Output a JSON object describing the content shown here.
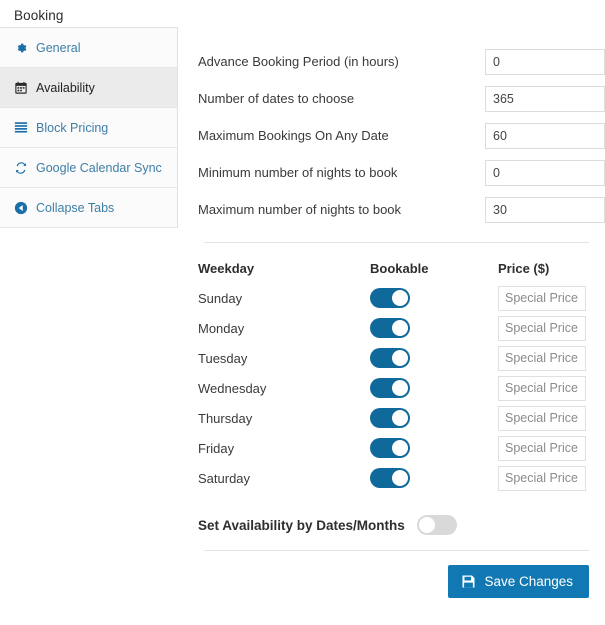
{
  "header": {
    "title": "Booking"
  },
  "sidebar": {
    "items": [
      {
        "label": "General",
        "icon": "gear-icon",
        "active": false
      },
      {
        "label": "Availability",
        "icon": "calendar-icon",
        "active": true
      },
      {
        "label": "Block Pricing",
        "icon": "list-bars-icon",
        "active": false
      },
      {
        "label": "Google Calendar Sync",
        "icon": "sync-refresh-icon",
        "active": false
      },
      {
        "label": "Collapse Tabs",
        "icon": "circle-caret-left-icon",
        "active": false
      }
    ]
  },
  "main": {
    "fields": [
      {
        "label": "Advance Booking Period (in hours)",
        "value": "0"
      },
      {
        "label": "Number of dates to choose",
        "value": "365"
      },
      {
        "label": "Maximum Bookings On Any Date",
        "value": "60"
      },
      {
        "label": "Minimum number of nights to book",
        "value": "0"
      },
      {
        "label": "Maximum number of nights to book",
        "value": "30"
      }
    ],
    "weekday_table": {
      "headers": {
        "day": "Weekday",
        "bookable": "Bookable",
        "price": "Price ($)"
      },
      "price_placeholder": "Special Price",
      "rows": [
        {
          "day": "Sunday",
          "bookable": true,
          "price": ""
        },
        {
          "day": "Monday",
          "bookable": true,
          "price": ""
        },
        {
          "day": "Tuesday",
          "bookable": true,
          "price": ""
        },
        {
          "day": "Wednesday",
          "bookable": true,
          "price": ""
        },
        {
          "day": "Thursday",
          "bookable": true,
          "price": ""
        },
        {
          "day": "Friday",
          "bookable": true,
          "price": ""
        },
        {
          "day": "Saturday",
          "bookable": true,
          "price": ""
        }
      ]
    },
    "availability_toggle": {
      "label": "Set Availability by Dates/Months",
      "on": false
    },
    "save_button": {
      "label": "Save Changes",
      "icon": "floppy-save-icon"
    }
  },
  "colors": {
    "accent_blue": "#1278b3",
    "toggle_on": "#10699b",
    "toggle_off": "#d9d9d9",
    "sidebar_link": "#3d7ea6",
    "active_row_bg": "#ebebeb"
  }
}
